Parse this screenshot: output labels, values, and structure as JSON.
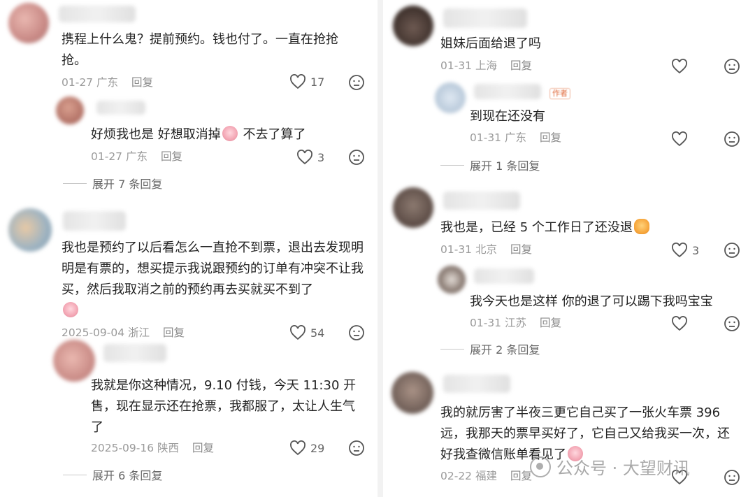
{
  "left": {
    "comments": [
      {
        "text": "携程上什么鬼？提前预约。钱也付了。一直在抢抢抢。",
        "date": "01-27",
        "location": "广东",
        "reply_label": "回复",
        "likes": "17",
        "reply": {
          "text_a": "好烦我也是 好想取消掉",
          "text_b": " 不去了算了",
          "date": "01-27",
          "location": "广东",
          "reply_label": "回复",
          "likes": "3",
          "expand_label": "展开 7 条回复"
        }
      },
      {
        "text": "我也是预约了以后看怎么一直抢不到票，退出去发现明明是有票的，想买提示我说跟预约的订单有冲突不让我买，然后我取消之前的预约再去买就买不到了",
        "date": "2025-09-04",
        "location": "浙江",
        "reply_label": "回复",
        "likes": "54",
        "reply": {
          "text": "我就是你这种情况，9.10 付钱，今天 11:30 开售，现在显示还在抢票，我都服了，太让人生气了",
          "date": "2025-09-16",
          "location": "陕西",
          "reply_label": "回复",
          "likes": "29",
          "expand_label": "展开 6 条回复"
        }
      }
    ]
  },
  "right": {
    "comments": [
      {
        "text": "姐妹后面给退了吗",
        "date": "01-31",
        "location": "上海",
        "reply_label": "回复",
        "reply": {
          "author_tag": "作者",
          "text": "到现在还没有",
          "date": "01-31",
          "location": "广东",
          "reply_label": "回复",
          "expand_label": "展开 1 条回复"
        }
      },
      {
        "text": "我也是，已经 5 个工作日了还没退",
        "date": "01-31",
        "location": "北京",
        "reply_label": "回复",
        "likes": "3",
        "reply": {
          "text": "我今天也是这样 你的退了可以踢下我吗宝宝",
          "date": "01-31",
          "location": "江苏",
          "reply_label": "回复",
          "expand_label": "展开 2 条回复"
        }
      },
      {
        "text": "我的就厉害了半夜三更它自己买了一张火车票 396 远，我那天的票早买好了，它自己又给我买一次，还好我查微信账单看见了",
        "date": "02-22",
        "location": "福建",
        "reply_label": "回复"
      }
    ]
  },
  "watermark": {
    "text": "公众号 · 大望财讯"
  },
  "icons": {
    "like": "heart-outline-icon",
    "dislike": "neutral-face-icon",
    "emoji_cry": "crying-face-emoji",
    "emoji_cat": "cat-face-emoji"
  }
}
